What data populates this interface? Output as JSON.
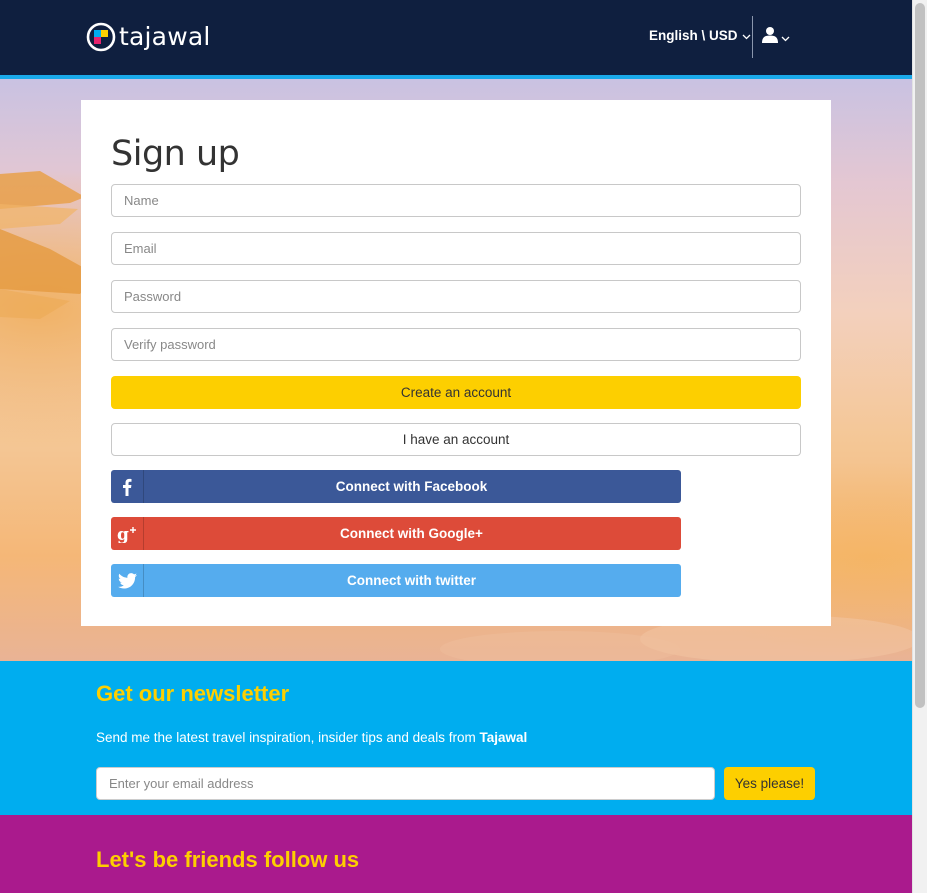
{
  "header": {
    "brand": "tajawal",
    "language_currency": "English \\ USD",
    "user_icon": "user-icon"
  },
  "signup": {
    "title": "Sign up",
    "name_placeholder": "Name",
    "email_placeholder": "Email",
    "password_placeholder": "Password",
    "verify_placeholder": "Verify password",
    "create_label": "Create an account",
    "have_account_label": "I have an account",
    "facebook_label": "Connect with Facebook",
    "google_label": "Connect with Google+",
    "twitter_label": "Connect with twitter"
  },
  "newsletter": {
    "title": "Get our newsletter",
    "description": "Send me the latest travel inspiration, insider tips and deals from ",
    "brand": "Tajawal",
    "email_placeholder": "Enter your email address",
    "submit_label": "Yes please!"
  },
  "social_section": {
    "title": "Let's be friends follow us"
  },
  "colors": {
    "header_bg": "#0f1f3f",
    "accent_blue": "#1aa9e9",
    "yellow": "#fdcf00",
    "facebook": "#3b5898",
    "google": "#dd4b39",
    "twitter": "#55acee",
    "newsletter_bg": "#00adef",
    "friends_bg": "#aa1a8d"
  }
}
